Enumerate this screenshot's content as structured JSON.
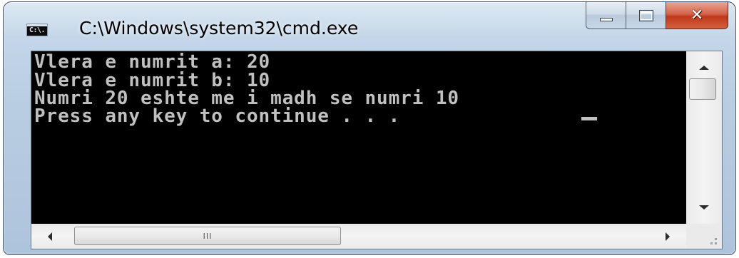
{
  "window": {
    "title": "C:\\Windows\\system32\\cmd.exe",
    "icon_label": "C:\\.",
    "icon_name": "command-prompt-icon",
    "controls": {
      "minimize_icon": "minimize-icon",
      "maximize_icon": "maximize-icon",
      "close_icon": "close-icon",
      "close_glyph": "✕"
    }
  },
  "console": {
    "lines": [
      "Vlera e numrit a: 20",
      "Vlera e numrit b: 10",
      "Numri 20 eshte me i madh se numri 10",
      "Press any key to continue . . ."
    ],
    "text_color": "#c0c0c0",
    "background_color": "#000000"
  },
  "scrollbars": {
    "horizontal_grip": "III"
  }
}
